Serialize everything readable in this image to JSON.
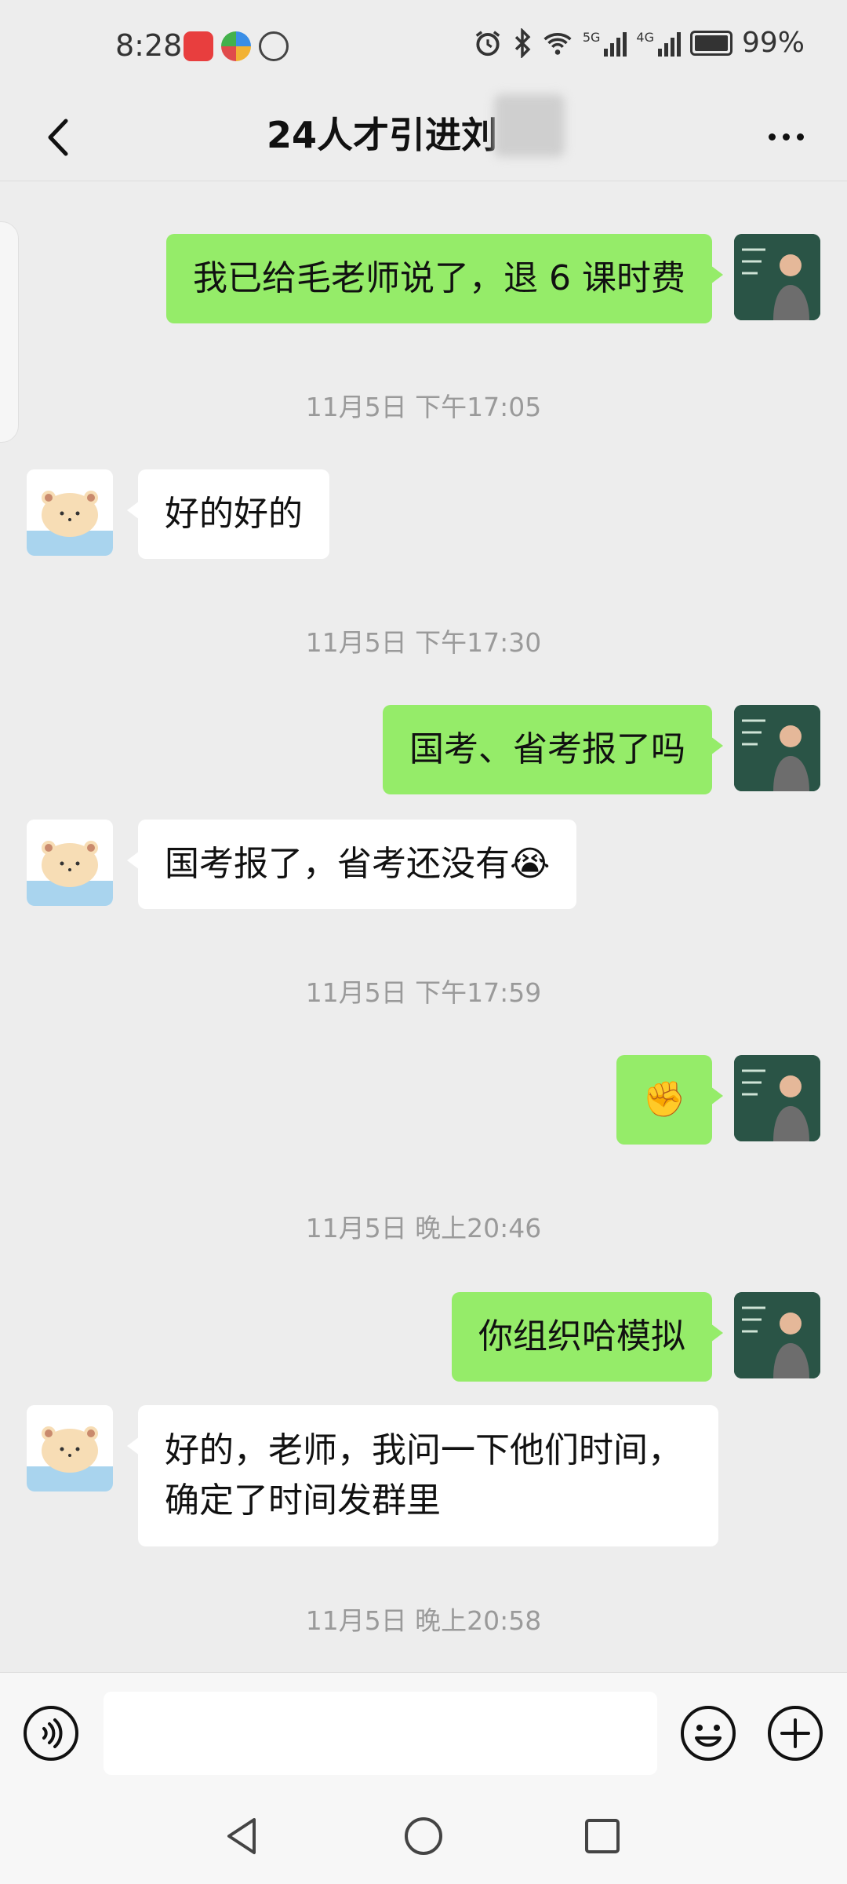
{
  "status_bar": {
    "time": "8:28",
    "network_1": "5G",
    "network_2": "4G",
    "battery": "99%"
  },
  "header": {
    "title": "24人才引进刘"
  },
  "messages": [
    {
      "side": "out",
      "text": "我已给毛老师说了，退 6 课时费"
    },
    {
      "timestamp": "11月5日 下午17:05"
    },
    {
      "side": "in",
      "text": "好的好的"
    },
    {
      "timestamp": "11月5日 下午17:30"
    },
    {
      "side": "out",
      "text": "国考、省考报了吗"
    },
    {
      "side": "in",
      "text": "国考报了，省考还没有😭"
    },
    {
      "timestamp": "11月5日 下午17:59"
    },
    {
      "side": "out",
      "text": "✊"
    },
    {
      "timestamp": "11月5日 晚上20:46"
    },
    {
      "side": "out",
      "text": "你组织哈模拟"
    },
    {
      "side": "in",
      "text": "好的，老师，我问一下他们时间，确定了时间发群里"
    },
    {
      "timestamp": "11月5日 晚上20:58"
    }
  ],
  "input": {
    "value": ""
  },
  "icons": {
    "back": "chevron-left-icon",
    "more": "more-dots-icon",
    "voice": "voice-icon",
    "emoji": "emoji-icon",
    "plus": "plus-icon"
  }
}
